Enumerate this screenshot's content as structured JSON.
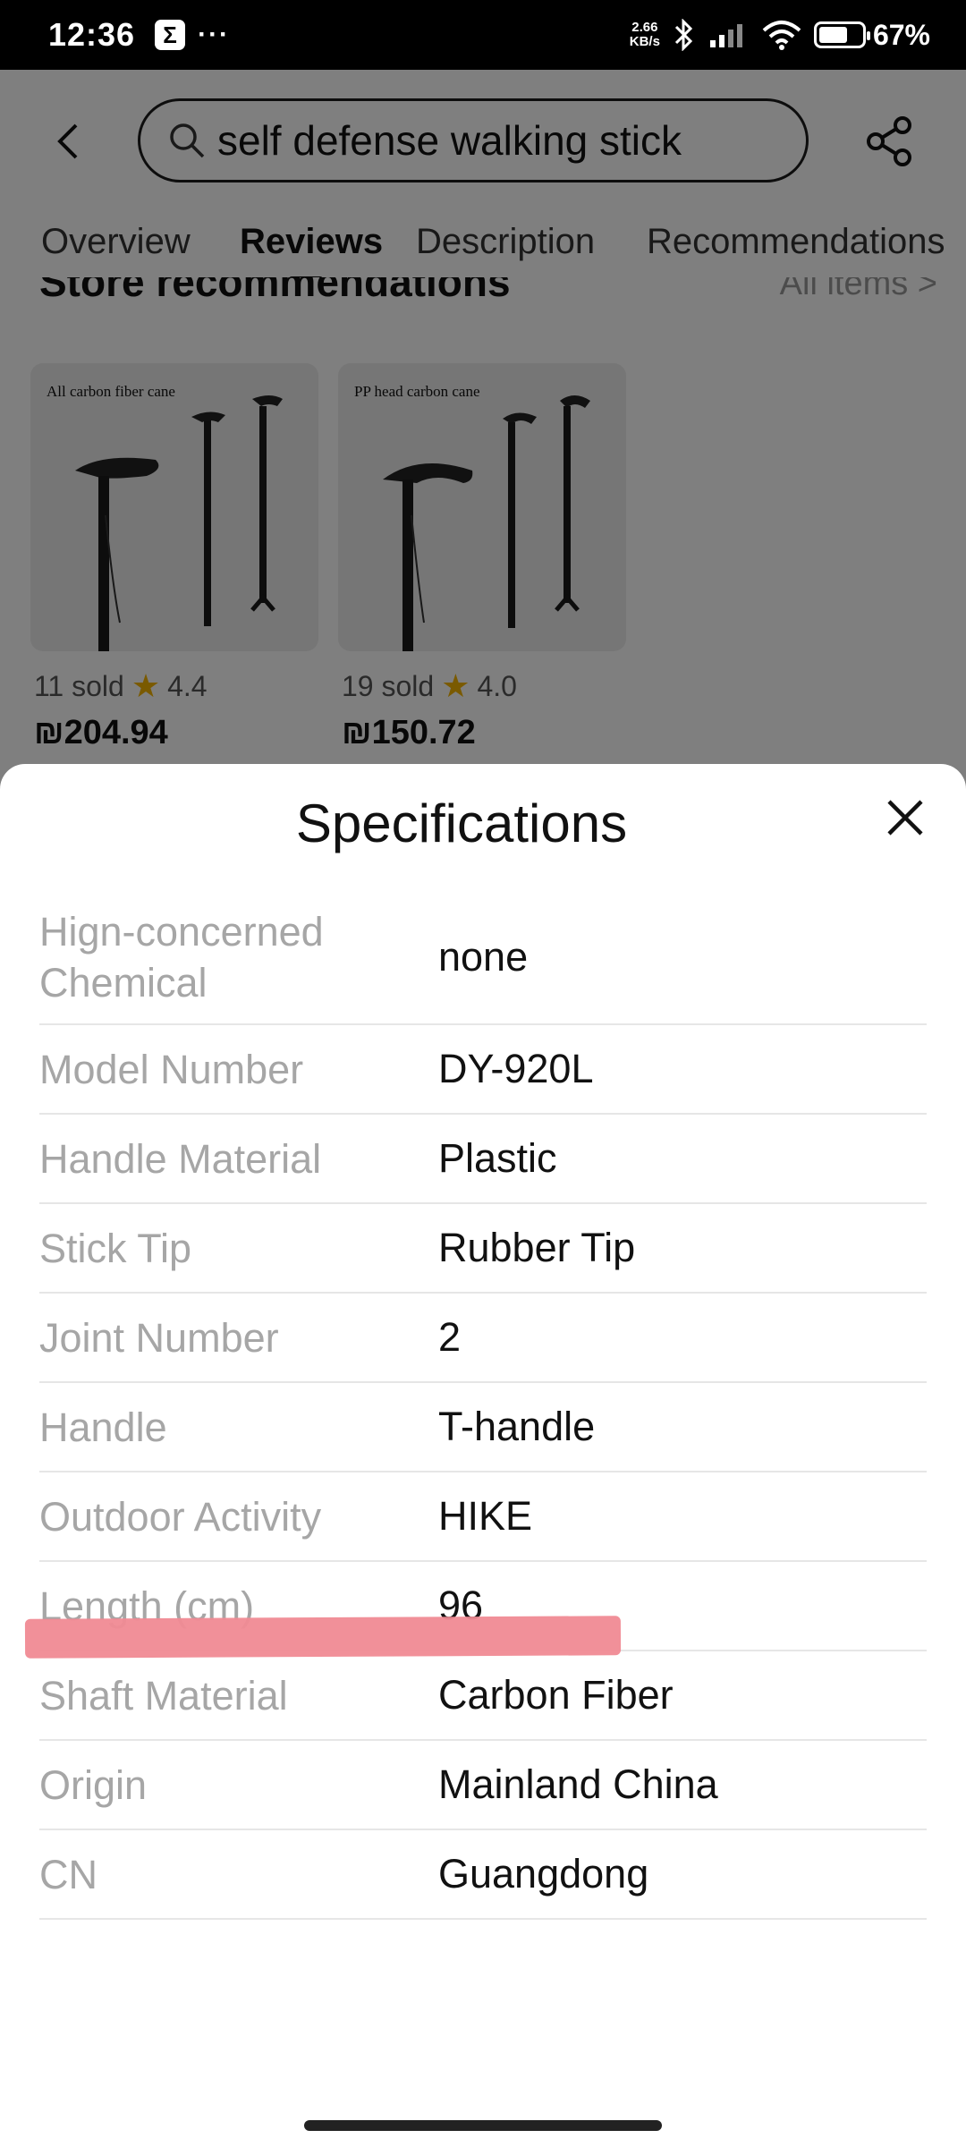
{
  "status_bar": {
    "time": "12:36",
    "app_icon": "Σ",
    "more": "···",
    "net_speed_value": "2.66",
    "net_speed_unit": "KB/s",
    "battery": "67%"
  },
  "header": {
    "search_query": "self defense walking stick",
    "tabs": [
      {
        "label": "Overview",
        "active": false
      },
      {
        "label": "Reviews",
        "active": true
      },
      {
        "label": "Description",
        "active": false
      },
      {
        "label": "Recommendations",
        "active": false
      }
    ]
  },
  "store": {
    "title": "Store recommendations",
    "all_items": "All items >",
    "cards": [
      {
        "caption": "All carbon fiber cane",
        "sold": "11 sold",
        "rating": "4.4",
        "price": "₪204.94"
      },
      {
        "caption": "PP head carbon cane",
        "sold": "19 sold",
        "rating": "4.0",
        "price": "₪150.72"
      }
    ]
  },
  "specs": {
    "title": "Specifications",
    "rows": [
      {
        "label": "Hign-concerned Chemical",
        "value": "none"
      },
      {
        "label": "Model Number",
        "value": "DY-920L"
      },
      {
        "label": "Handle Material",
        "value": "Plastic"
      },
      {
        "label": "Stick Tip",
        "value": "Rubber Tip"
      },
      {
        "label": "Joint Number",
        "value": "2"
      },
      {
        "label": "Handle",
        "value": "T-handle"
      },
      {
        "label": "Outdoor Activity",
        "value": "HIKE"
      },
      {
        "label": "Length (cm)",
        "value": "96"
      },
      {
        "label": "Shaft Material",
        "value": "Carbon Fiber"
      },
      {
        "label": "Origin",
        "value": "Mainland China"
      },
      {
        "label": "CN",
        "value": "Guangdong"
      }
    ]
  },
  "colors": {
    "highlight": "#f08a93",
    "star": "#f5b400"
  }
}
